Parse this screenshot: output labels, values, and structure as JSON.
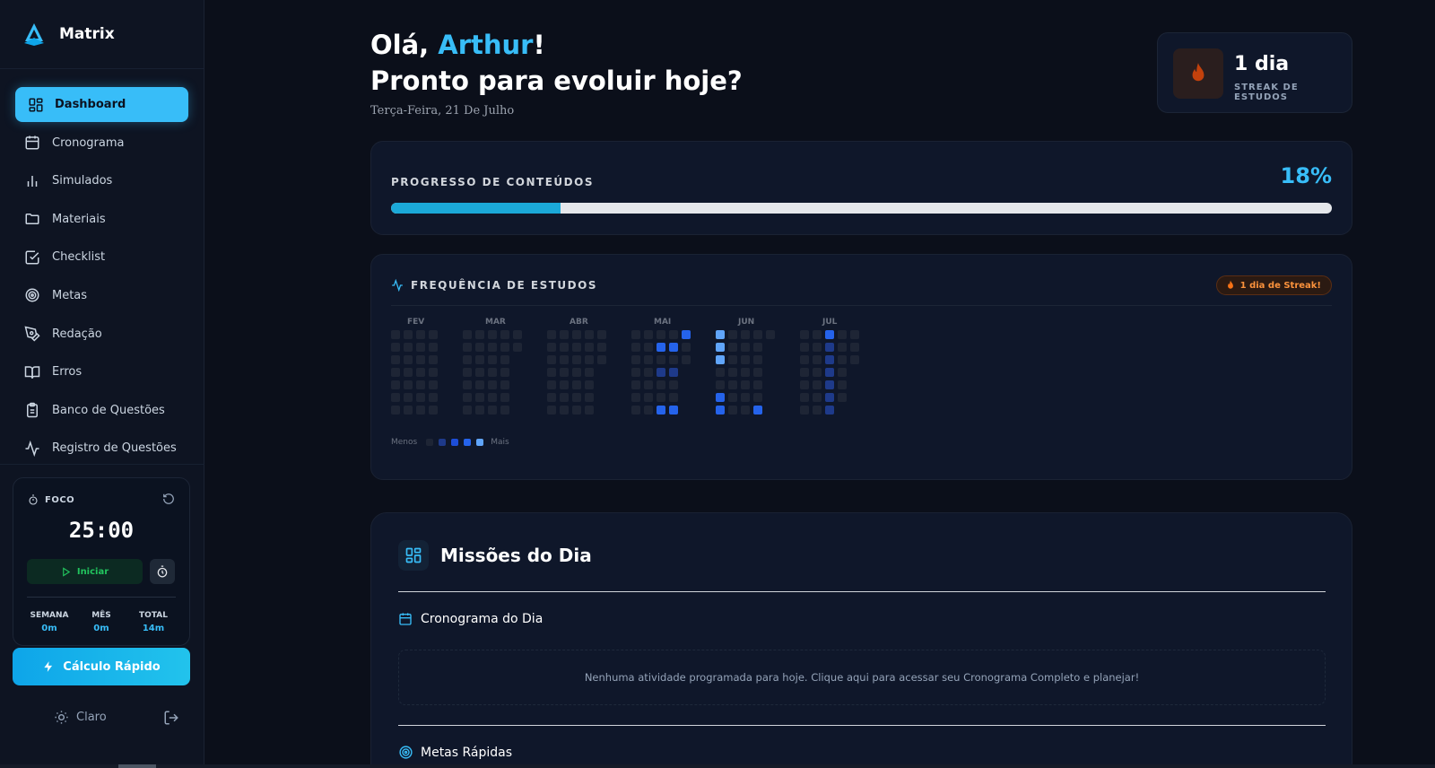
{
  "app": {
    "name": "Matrix"
  },
  "nav": {
    "items": [
      {
        "label": "Dashboard",
        "icon": "dashboard-icon",
        "active": true
      },
      {
        "label": "Cronograma",
        "icon": "calendar-icon"
      },
      {
        "label": "Simulados",
        "icon": "bar-chart-icon"
      },
      {
        "label": "Materiais",
        "icon": "folder-icon"
      },
      {
        "label": "Checklist",
        "icon": "checklist-icon"
      },
      {
        "label": "Metas",
        "icon": "target-icon"
      },
      {
        "label": "Redação",
        "icon": "pen-icon"
      },
      {
        "label": "Erros",
        "icon": "book-icon"
      },
      {
        "label": "Banco de Questões",
        "icon": "clipboard-icon"
      },
      {
        "label": "Registro de Questões",
        "icon": "activity-icon"
      }
    ]
  },
  "focus": {
    "label": "FOCO",
    "timer": "25:00",
    "start_label": "Iniciar",
    "stats": [
      {
        "label": "SEMANA",
        "value": "0m"
      },
      {
        "label": "MÊS",
        "value": "0m"
      },
      {
        "label": "TOTAL",
        "value": "14m"
      }
    ]
  },
  "quick_calc": {
    "label": "Cálculo Rápido"
  },
  "theme": {
    "label": "Claro"
  },
  "header": {
    "greeting_prefix": "Olá, ",
    "user_name": "Arthur",
    "greeting_suffix": "!",
    "subtitle": "Pronto para evoluir hoje?",
    "date": "Terça-Feira, 21 De Julho"
  },
  "streak": {
    "value": "1 dia",
    "label": "STREAK DE ESTUDOS"
  },
  "progress": {
    "label": "PROGRESSO DE CONTEÚDOS",
    "percent_label": "18%",
    "percent": 18
  },
  "frequency": {
    "title": "FREQUÊNCIA DE ESTUDOS",
    "badge": "1 dia de Streak!",
    "legend_less": "Menos",
    "legend_more": "Mais",
    "colors": [
      "#1e2535",
      "#1e3a8a",
      "#1d4ed8",
      "#2563eb",
      "#60a5fa"
    ],
    "months": [
      {
        "label": "FEV",
        "columns": [
          [
            0,
            0,
            0,
            0,
            0,
            0,
            0
          ],
          [
            0,
            0,
            0,
            0,
            0,
            0,
            0
          ],
          [
            0,
            0,
            0,
            0,
            0,
            0,
            0
          ],
          [
            0,
            0,
            0,
            0,
            0,
            0,
            0
          ]
        ]
      },
      {
        "label": "MAR",
        "columns": [
          [
            0,
            0,
            0,
            0,
            0,
            0,
            0
          ],
          [
            0,
            0,
            0,
            0,
            0,
            0,
            0
          ],
          [
            0,
            0,
            0,
            0,
            0,
            0,
            0
          ],
          [
            0,
            0,
            0,
            0,
            0,
            0,
            0
          ],
          [
            0,
            0,
            null,
            null,
            null,
            null,
            null
          ]
        ]
      },
      {
        "label": "ABR",
        "columns": [
          [
            0,
            0,
            0,
            0,
            0,
            0,
            0
          ],
          [
            0,
            0,
            0,
            0,
            0,
            0,
            0
          ],
          [
            0,
            0,
            0,
            0,
            0,
            0,
            0
          ],
          [
            0,
            0,
            0,
            0,
            0,
            0,
            0
          ],
          [
            0,
            0,
            0,
            null,
            null,
            null,
            null
          ]
        ]
      },
      {
        "label": "MAI",
        "columns": [
          [
            0,
            0,
            0,
            0,
            0,
            0,
            0
          ],
          [
            0,
            0,
            0,
            0,
            0,
            0,
            0
          ],
          [
            0,
            3,
            0,
            1,
            0,
            0,
            3
          ],
          [
            0,
            3,
            0,
            1,
            0,
            0,
            3
          ],
          [
            3,
            0,
            0,
            null,
            null,
            null,
            null
          ]
        ]
      },
      {
        "label": "JUN",
        "columns": [
          [
            4,
            4,
            4,
            0,
            0,
            3,
            3
          ],
          [
            0,
            0,
            0,
            0,
            0,
            0,
            0
          ],
          [
            0,
            0,
            0,
            0,
            0,
            0,
            0
          ],
          [
            0,
            0,
            0,
            0,
            0,
            0,
            3
          ],
          [
            0,
            null,
            null,
            null,
            null,
            null,
            null
          ]
        ]
      },
      {
        "label": "JUL",
        "columns": [
          [
            0,
            0,
            0,
            0,
            0,
            0,
            0
          ],
          [
            0,
            0,
            0,
            0,
            0,
            0,
            0
          ],
          [
            3,
            1,
            1,
            1,
            1,
            1,
            1
          ],
          [
            0,
            0,
            0,
            0,
            0,
            0,
            null
          ],
          [
            0,
            0,
            0,
            null,
            null,
            null,
            null
          ]
        ]
      }
    ]
  },
  "missions": {
    "title": "Missões do Dia",
    "schedule_title": "Cronograma do Dia",
    "empty_message": "Nenhuma atividade programada para hoje. Clique aqui para acessar seu Cronograma Completo e planejar!",
    "goals_title": "Metas Rápidas"
  }
}
